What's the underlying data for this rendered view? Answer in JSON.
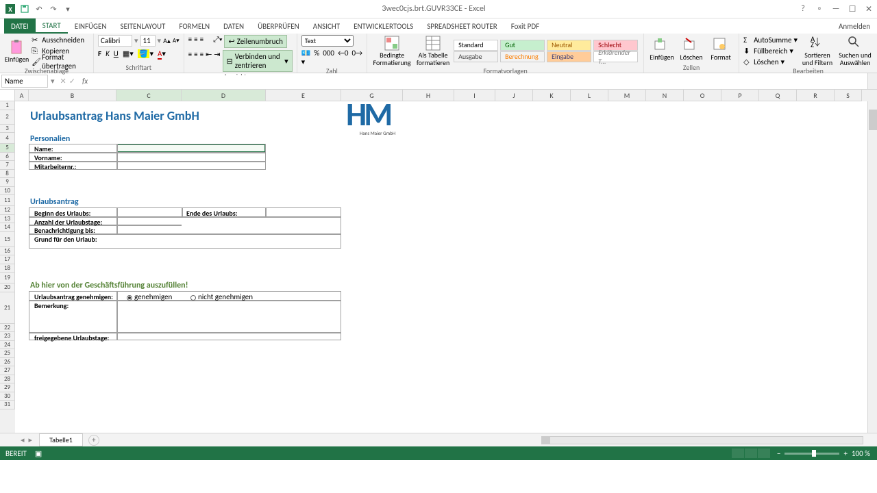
{
  "app": {
    "title": "3wec0cjs.brt.GUVR33CE - Excel",
    "signin": "Anmelden"
  },
  "tabs": [
    "DATEI",
    "START",
    "EINFÜGEN",
    "SEITENLAYOUT",
    "FORMELN",
    "DATEN",
    "ÜBERPRÜFEN",
    "ANSICHT",
    "ENTWICKLERTOOLS",
    "SPREADSHEET ROUTER",
    "Foxit PDF"
  ],
  "active_tab": "START",
  "ribbon": {
    "clipboard": {
      "label": "Zwischenablage",
      "paste": "Einfügen",
      "cut": "Ausschneiden",
      "copy": "Kopieren",
      "format": "Format übertragen"
    },
    "font": {
      "label": "Schriftart",
      "name": "Calibri",
      "size": "11"
    },
    "alignment": {
      "label": "Ausrichtung",
      "wrap": "Zeilenumbruch",
      "merge": "Verbinden und zentrieren"
    },
    "number": {
      "label": "Zahl",
      "format": "Text"
    },
    "styles": {
      "label": "Formatvorlagen",
      "conditional": "Bedingte Formatierung",
      "table": "Als Tabelle formatieren",
      "cells": [
        {
          "name": "Standard",
          "bg": "#fff",
          "color": "#000"
        },
        {
          "name": "Gut",
          "bg": "#c6efce",
          "color": "#006100"
        },
        {
          "name": "Neutral",
          "bg": "#ffeb9c",
          "color": "#9c5700"
        },
        {
          "name": "Schlecht",
          "bg": "#ffc7ce",
          "color": "#9c0006"
        },
        {
          "name": "Ausgabe",
          "bg": "#f2f2f2",
          "color": "#3f3f3f"
        },
        {
          "name": "Berechnung",
          "bg": "#f2f2f2",
          "color": "#fa7d00"
        },
        {
          "name": "Eingabe",
          "bg": "#ffcc99",
          "color": "#3f3f76"
        },
        {
          "name": "Erklärender T...",
          "bg": "#fff",
          "color": "#7f7f7f"
        }
      ]
    },
    "cells": {
      "label": "Zellen",
      "insert": "Einfügen",
      "delete": "Löschen",
      "format": "Format"
    },
    "editing": {
      "label": "Bearbeiten",
      "sum": "AutoSumme",
      "fill": "Füllbereich",
      "clear": "Löschen",
      "sort": "Sortieren und Filtern",
      "find": "Suchen und Auswählen"
    }
  },
  "namebox": "Name",
  "columns": [
    "A",
    "B",
    "C",
    "D",
    "E",
    "G",
    "H",
    "I",
    "J",
    "K",
    "L",
    "M",
    "N",
    "O",
    "P",
    "Q",
    "R",
    "S"
  ],
  "doc": {
    "title": "Urlaubsantrag Hans Maier GmbH",
    "logo_sub": "Hans Maier GmbH",
    "sec1": "Personalien",
    "name": "Name:",
    "vorname": "Vorname:",
    "mitnr": "Mitarbeiternr.:",
    "sec2": "Urlaubsantrag",
    "beginn": "Beginn des Urlaubs:",
    "ende": "Ende des Urlaubs:",
    "anzahl": "Anzahl der Urlaubstage:",
    "benach": "Benachrichtigung bis:",
    "grund": "Grund für den Urlaub:",
    "sec3": "Ab hier von der Geschäftsführung auszufüllen!",
    "genehm": "Urlaubsantrag genehmigen:",
    "opt1": "genehmigen",
    "opt2": "nicht genehmigen",
    "bemerk": "Bemerkung:",
    "freigeg": "freigegebene Urlaubstage:"
  },
  "sheet_tab": "Tabelle1",
  "status": {
    "ready": "BEREIT",
    "zoom": "100 %"
  }
}
